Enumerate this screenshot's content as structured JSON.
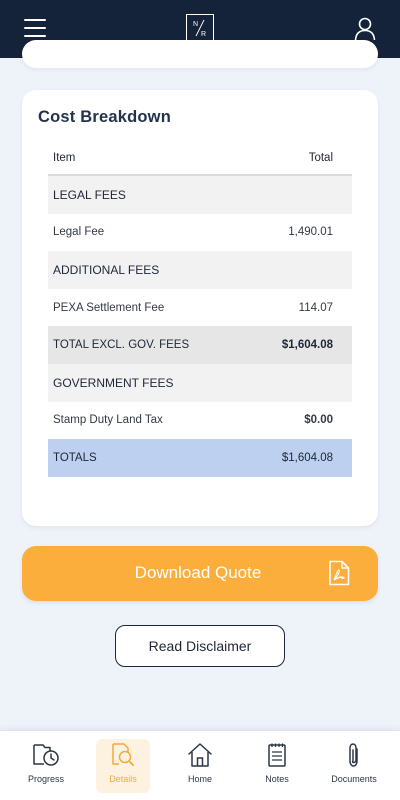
{
  "header": {
    "logo_text": "N/R",
    "menu_icon": "hamburger-menu-icon",
    "user_icon": "user-icon"
  },
  "cost_breakdown": {
    "title": "Cost Breakdown",
    "columns": {
      "item": "Item",
      "total": "Total"
    },
    "legal_fees_heading": "LEGAL FEES",
    "legal_fee_label": "Legal Fee",
    "legal_fee_value": "1,490.01",
    "additional_fees_heading": "ADDITIONAL FEES",
    "pexa_label": "PEXA Settlement Fee",
    "pexa_value": "114.07",
    "total_excl_label": "TOTAL EXCL. GOV. FEES",
    "total_excl_value": "$1,604.08",
    "government_fees_heading": "GOVERNMENT FEES",
    "stamp_duty_label": "Stamp Duty Land Tax",
    "stamp_duty_value": "$0.00",
    "totals_label": "TOTALS",
    "totals_value": "$1,604.08"
  },
  "actions": {
    "download_label": "Download Quote",
    "download_icon": "pdf-file-icon",
    "disclaimer_label": "Read Disclaimer"
  },
  "bottom_nav": {
    "progress": "Progress",
    "details": "Details",
    "home": "Home",
    "notes": "Notes",
    "documents": "Documents",
    "active": "Details"
  },
  "colors": {
    "header_bg": "#142339",
    "page_bg": "#eef3fa",
    "accent_orange": "#fbae3c",
    "totals_row": "#bdd0f0",
    "subtotal_row": "#e6e6e6"
  }
}
